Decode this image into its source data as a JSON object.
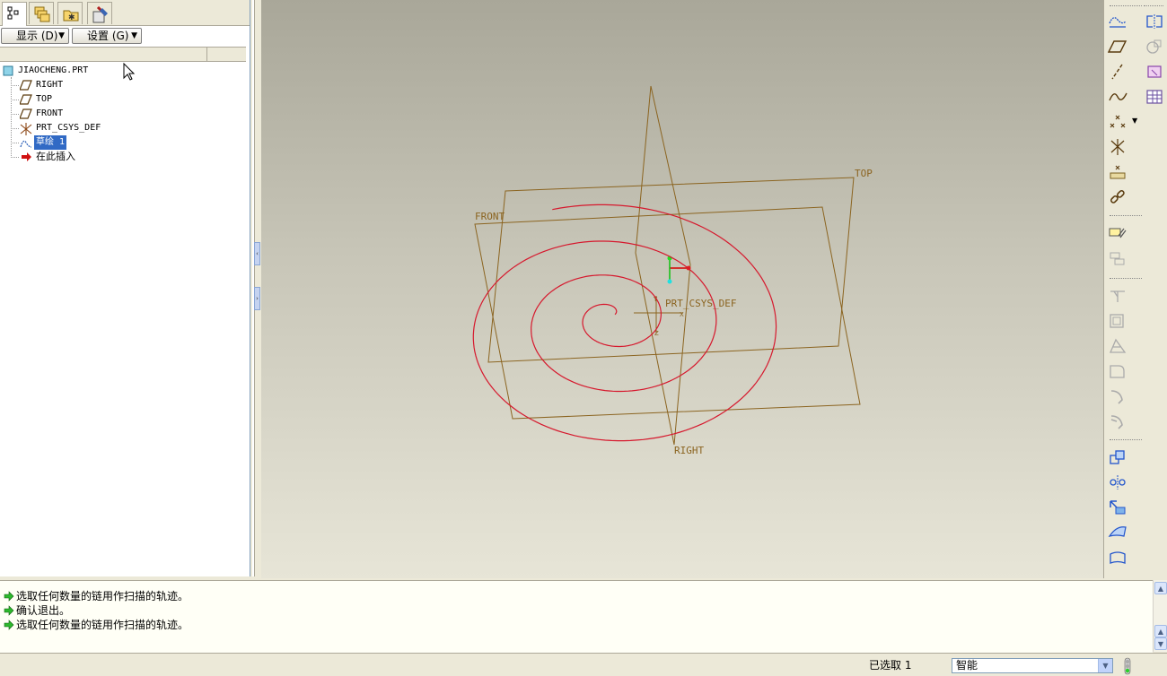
{
  "left_panel": {
    "tabs": [
      {
        "icon": "model-tree-icon"
      },
      {
        "icon": "layers-icon"
      },
      {
        "icon": "folder-browser-icon"
      },
      {
        "icon": "favorites-icon"
      }
    ],
    "show_button": "显示 (D)",
    "settings_button": "设置 (G)",
    "tree": {
      "root": "JIAOCHENG.PRT",
      "items": [
        {
          "label": "RIGHT",
          "icon": "datum-plane-icon"
        },
        {
          "label": "TOP",
          "icon": "datum-plane-icon"
        },
        {
          "label": "FRONT",
          "icon": "datum-plane-icon"
        },
        {
          "label": "PRT_CSYS_DEF",
          "icon": "coordinate-system-icon"
        },
        {
          "label": "草绘 1",
          "icon": "sketch-icon",
          "selected": true
        },
        {
          "label": "在此插入",
          "icon": "insert-here-arrow-icon"
        }
      ]
    }
  },
  "viewport": {
    "labels": {
      "top": "TOP",
      "front": "FRONT",
      "right": "RIGHT",
      "csys": "PRT_CSYS_DEF"
    },
    "colors": {
      "datum": "#8b6420",
      "sketch": "#d6182d",
      "background_top": "#a9a799",
      "background_bottom": "#e7e5d7"
    }
  },
  "messages": [
    "选取任何数量的链用作扫描的轨迹。",
    "确认退出。",
    "选取任何数量的链用作扫描的轨迹。"
  ],
  "status": {
    "selected": "已选取 1",
    "filter": "智能"
  }
}
